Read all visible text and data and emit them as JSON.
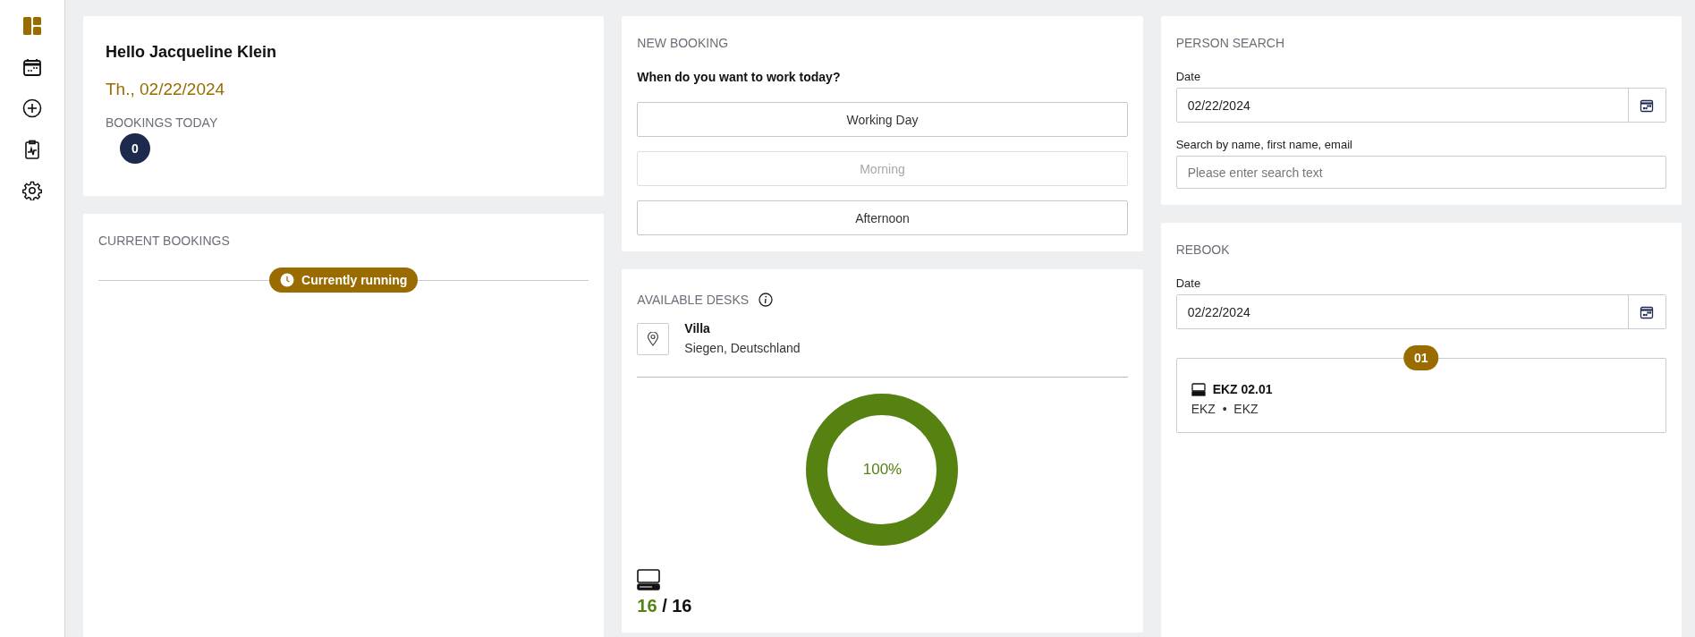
{
  "sidebar": {
    "items": [
      {
        "kind": "dashboard",
        "selected": true
      },
      {
        "kind": "calendar",
        "selected": false
      },
      {
        "kind": "add",
        "selected": false
      },
      {
        "kind": "report",
        "selected": false
      },
      {
        "kind": "settings",
        "selected": false
      }
    ]
  },
  "welcome": {
    "greeting": "Hello Jacqueline Klein",
    "date": "Th., 02/22/2024",
    "bookings_label": "BOOKINGS TODAY",
    "bookings_count": "0"
  },
  "current_bookings": {
    "title": "CURRENT BOOKINGS",
    "divider_badge": "Currently running"
  },
  "new_booking": {
    "title": "NEW BOOKING",
    "question": "When do you want to work today?",
    "options": [
      {
        "label": "Working Day",
        "disabled": false
      },
      {
        "label": "Morning",
        "disabled": true
      },
      {
        "label": "Afternoon",
        "disabled": false
      }
    ]
  },
  "available_desks": {
    "title": "AVAILABLE DESKS",
    "location_name": "Villa",
    "location_place": "Siegen, Deutschland",
    "level": 1,
    "percent": "100%",
    "available": "16",
    "separator": "/",
    "total": "16"
  },
  "person_search": {
    "title": "PERSON SEARCH",
    "date_label": "Date",
    "date_value": "02/22/2024",
    "search_label": "Search by name, first name, email",
    "search_placeholder": "Please enter search text"
  },
  "rebook": {
    "title": "REBOOK",
    "date_label": "Date",
    "date_value": "02/22/2024",
    "bookings": [
      {
        "badge": "01",
        "desk": "EKZ 02.01",
        "building": "EKZ",
        "separator": "•",
        "floor": "EKZ"
      }
    ]
  }
}
